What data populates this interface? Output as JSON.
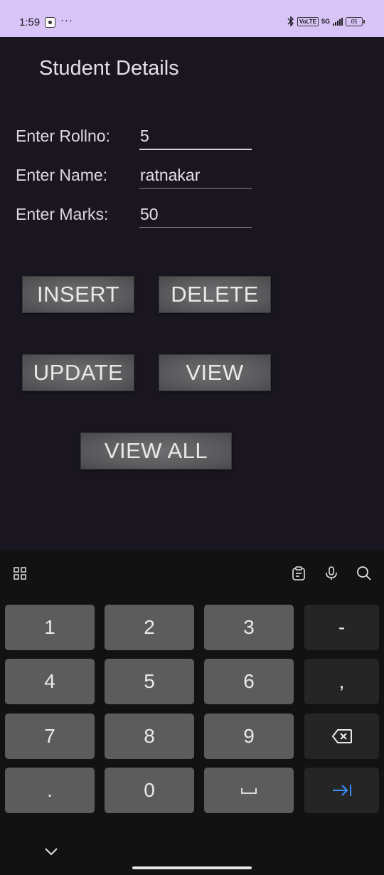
{
  "status_bar": {
    "time": "1:59",
    "more": "···",
    "volte": "VoLTE",
    "network": "5G",
    "battery": "65"
  },
  "app": {
    "title": "Student Details"
  },
  "form": {
    "rollno_label": "Enter Rollno:",
    "rollno_value": "5",
    "name_label": "Enter Name:",
    "name_value": "ratnakar",
    "marks_label": "Enter Marks:",
    "marks_value": "50"
  },
  "buttons": {
    "insert": "INSERT",
    "delete": "DELETE",
    "update": "UPDATE",
    "view": "VIEW",
    "view_all": "VIEW ALL"
  },
  "keyboard": {
    "keys": {
      "k1": "1",
      "k2": "2",
      "k3": "3",
      "minus": "-",
      "k4": "4",
      "k5": "5",
      "k6": "6",
      "comma": ",",
      "k7": "7",
      "k8": "8",
      "k9": "9",
      "dot": ".",
      "k0": "0"
    },
    "icons": [
      "apps-grid-icon",
      "clipboard-icon",
      "microphone-icon",
      "search-icon",
      "backspace-icon",
      "space-icon",
      "tab-next-icon",
      "chevron-down-icon"
    ],
    "accent_color": "#3d8bff"
  }
}
